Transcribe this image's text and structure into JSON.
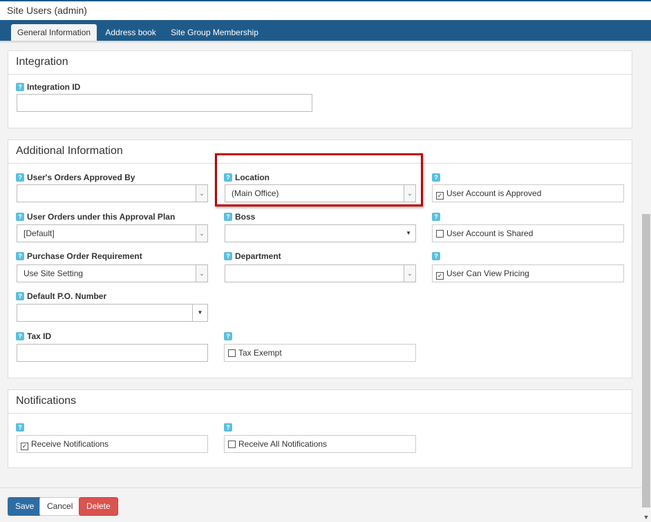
{
  "title": "Site Users (admin)",
  "tabs": [
    "General Information",
    "Address book",
    "Site Group Membership"
  ],
  "help_glyph": "?",
  "integration": {
    "header": "Integration",
    "integration_id_label": "Integration ID",
    "integration_id_value": ""
  },
  "additional": {
    "header": "Additional Information",
    "orders_approved_by": {
      "label": "User's Orders Approved By",
      "value": ""
    },
    "location": {
      "label": "Location",
      "value": "(Main Office)"
    },
    "account_approved": {
      "label": "User Account is Approved",
      "checked": true
    },
    "approval_plan": {
      "label": "User Orders under this Approval Plan",
      "value": "[Default]"
    },
    "boss": {
      "label": "Boss",
      "value": ""
    },
    "account_shared": {
      "label": "User Account is Shared",
      "checked": false
    },
    "po_requirement": {
      "label": "Purchase Order Requirement",
      "value": "Use Site Setting"
    },
    "department": {
      "label": "Department",
      "value": ""
    },
    "view_pricing": {
      "label": "User Can View Pricing",
      "checked": true
    },
    "default_po": {
      "label": "Default P.O. Number",
      "value": ""
    },
    "tax_id": {
      "label": "Tax ID",
      "value": ""
    },
    "tax_exempt": {
      "label": "Tax Exempt",
      "checked": false
    }
  },
  "notifications": {
    "header": "Notifications",
    "receive": {
      "label": "Receive Notifications",
      "checked": true
    },
    "receive_all": {
      "label": "Receive All Notifications",
      "checked": false
    }
  },
  "buttons": {
    "save": "Save",
    "cancel": "Cancel",
    "delete": "Delete"
  },
  "glyphs": {
    "check": "✓",
    "chevron": "⌄",
    "caret": "▼"
  },
  "colors": {
    "tab_bar": "#1f5b8a",
    "save": "#2e6da4",
    "delete": "#d9534f",
    "help": "#5bc0de",
    "highlight": "#c00000"
  }
}
